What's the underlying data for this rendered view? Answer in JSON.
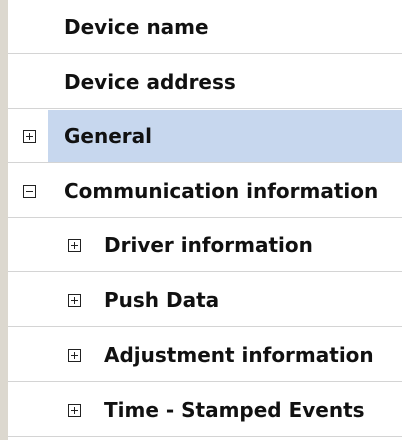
{
  "tree": {
    "rows": [
      {
        "label": "Device name",
        "expander": "none",
        "depth": 0,
        "selected": false
      },
      {
        "label": "Device address",
        "expander": "none",
        "depth": 0,
        "selected": false
      },
      {
        "label": "General",
        "expander": "collapsed",
        "depth": 0,
        "selected": true
      },
      {
        "label": "Communication information",
        "expander": "expanded",
        "depth": 0,
        "selected": false
      },
      {
        "label": "Driver information",
        "expander": "collapsed",
        "depth": 1,
        "selected": false
      },
      {
        "label": "Push Data",
        "expander": "collapsed",
        "depth": 1,
        "selected": false
      },
      {
        "label": "Adjustment information",
        "expander": "collapsed",
        "depth": 1,
        "selected": false
      },
      {
        "label": "Time - Stamped Events",
        "expander": "collapsed",
        "depth": 1,
        "selected": false
      }
    ]
  },
  "colors": {
    "selection": "#c7d7ee",
    "gutter": "#dcd8cf",
    "grid_line": "#d4d4d4"
  },
  "icons": {
    "collapsed": "plus-box-icon",
    "expanded": "minus-box-icon"
  }
}
